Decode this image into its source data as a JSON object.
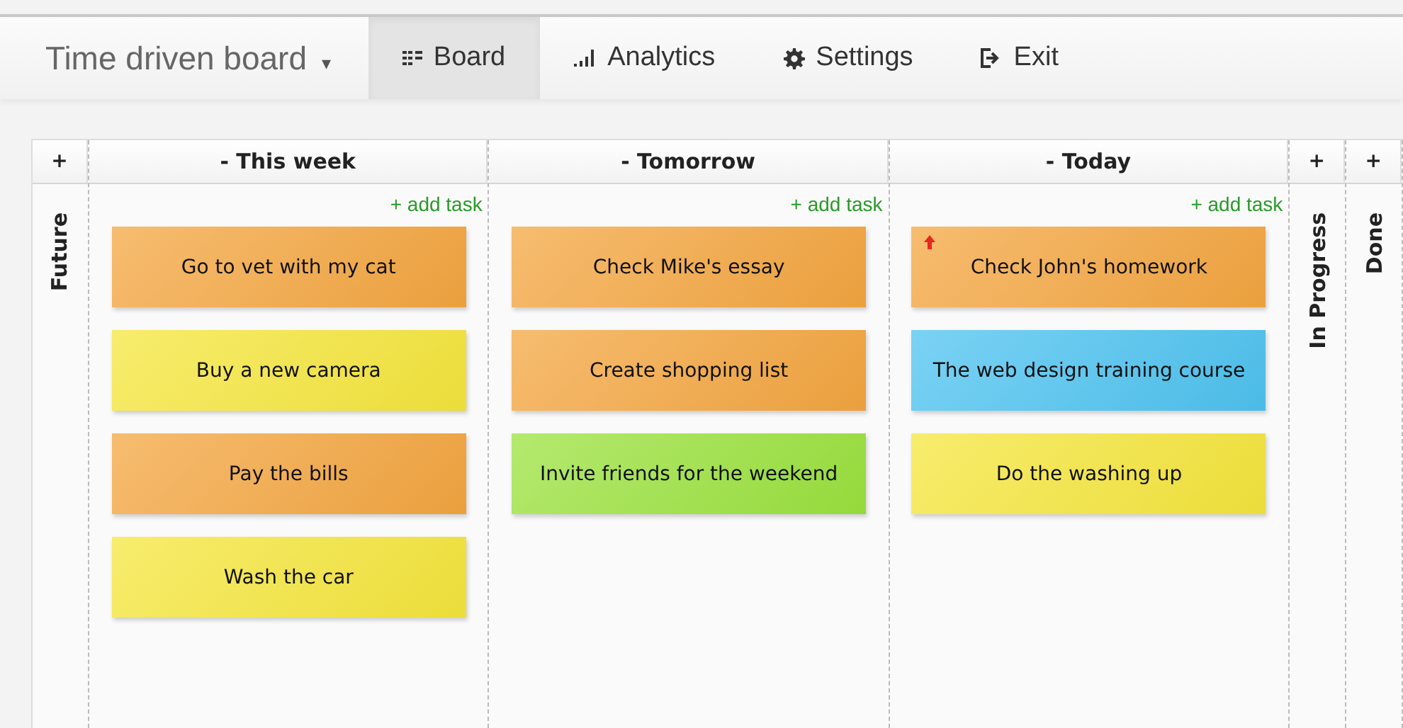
{
  "nav": {
    "title": "Time driven board",
    "caret": "▾",
    "tabs": [
      {
        "kind": "board",
        "label": "Board",
        "selected": true
      },
      {
        "kind": "analytics",
        "label": "Analytics",
        "selected": false
      },
      {
        "kind": "settings",
        "label": "Settings",
        "selected": false
      },
      {
        "kind": "exit",
        "label": "Exit",
        "selected": false
      }
    ]
  },
  "columns": [
    {
      "kind": "collapsed",
      "toggle": "+",
      "title": "Future"
    },
    {
      "kind": "expanded",
      "title": "- This week",
      "add": "+ add task",
      "cards": [
        {
          "text": "Go to vet with my cat",
          "color": "#f4a640",
          "urgent": false
        },
        {
          "text": "Buy a new camera",
          "color": "#f5e63c",
          "urgent": false
        },
        {
          "text": "Pay the bills",
          "color": "#f4a640",
          "urgent": false
        },
        {
          "text": "Wash the car",
          "color": "#f5e63c",
          "urgent": false
        }
      ]
    },
    {
      "kind": "expanded",
      "title": "- Tomorrow",
      "add": "+ add task",
      "cards": [
        {
          "text": "Check Mike's essay",
          "color": "#f4a640",
          "urgent": false
        },
        {
          "text": "Create shopping list",
          "color": "#f4a640",
          "urgent": false
        },
        {
          "text": "Invite friends for the weekend",
          "color": "#9be23e",
          "urgent": false
        }
      ]
    },
    {
      "kind": "expanded",
      "title": "- Today",
      "add": "+ add task",
      "cards": [
        {
          "text": "Check John's homework",
          "color": "#f4a640",
          "urgent": true
        },
        {
          "text": "The web design training course",
          "color": "#4ec3f0",
          "urgent": false
        },
        {
          "text": "Do the washing up",
          "color": "#f5e63c",
          "urgent": false
        }
      ]
    },
    {
      "kind": "collapsed",
      "toggle": "+",
      "title": "In Progress"
    },
    {
      "kind": "collapsed",
      "toggle": "+",
      "title": "Done"
    }
  ]
}
